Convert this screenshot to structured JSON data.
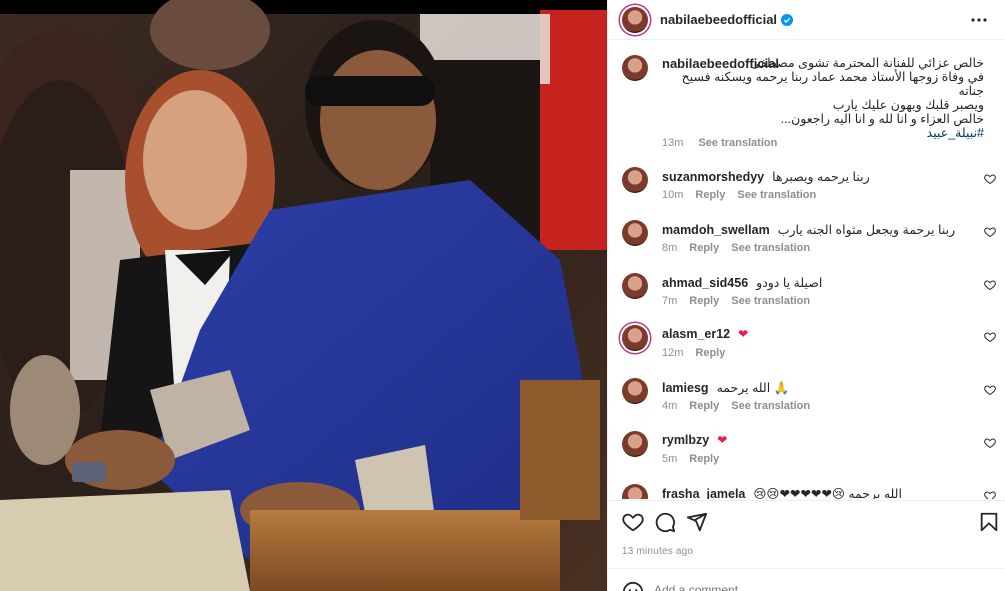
{
  "post": {
    "username": "nabilaebeedofficial",
    "caption_lines": [
      "خالص عزائي للفنانة المحترمة تشوى مصطفى",
      "في وفاة زوجها الأستاذ محمد عماد ربنا يرحمه ويسكنه فسيح جناته",
      "ويصبر قلبك ويهون عليك يارب",
      "خالص العزاء و انا لله و انا اليه راجعون..."
    ],
    "caption_hashtag": "#نبيلة_عبيد",
    "caption_time": "13m",
    "see_translation": "See translation",
    "time_ago": "13 minutes ago",
    "add_comment_placeholder": "Add a comment..."
  },
  "labels": {
    "reply": "Reply",
    "see_translation": "See translation"
  },
  "comments": [
    {
      "user": "suzanmorshedyy",
      "text": "ربنا يرحمه ويصبرها",
      "time": "10m",
      "reply": true,
      "translate": true
    },
    {
      "user": "mamdoh_swellam",
      "text": "ربنا يرحمة ويجعل مثواه الجنه يارب",
      "time": "8m",
      "reply": true,
      "translate": true
    },
    {
      "user": "ahmad_sid456",
      "text": "اصيلة يا دودو",
      "time": "7m",
      "reply": true,
      "translate": true
    },
    {
      "user": "alasm_er12",
      "text": "❤",
      "time": "12m",
      "reply": true,
      "translate": false
    },
    {
      "user": "lamiesg",
      "text": "🙏 الله يرحمه",
      "time": "4m",
      "reply": true,
      "translate": true
    },
    {
      "user": "rymlbzy",
      "text": "❤",
      "time": "5m",
      "reply": true,
      "translate": false
    },
    {
      "user": "frasha_jamela",
      "text": "الله يرحمه 😢❤❤❤❤❤😢😢",
      "time": "",
      "reply": false,
      "translate": false
    }
  ],
  "colors": {
    "accent": "#0095f6",
    "verified": "#0095f6",
    "heart_red": "#ed1c4b",
    "muted": "#8e8e8e",
    "link": "#00376b"
  },
  "icons": [
    "more-icon",
    "heart-icon",
    "comment-icon",
    "share-icon",
    "bookmark-icon",
    "smile-icon",
    "verified-icon"
  ]
}
